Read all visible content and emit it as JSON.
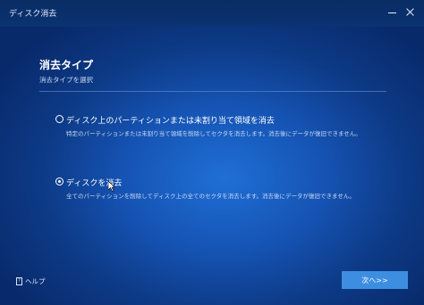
{
  "window": {
    "title": "ディスク消去",
    "minimize_icon": "minimize-icon",
    "close_icon": "close-icon"
  },
  "page": {
    "heading": "消去タイプ",
    "subheading": "消去タイプを選択"
  },
  "options": [
    {
      "label": "ディスク上のパーティションまたは未割り当て領域を消去",
      "description": "特定のパーティションまたは未割り当て領域を削除してセクタを消去します。消去後にデータが復旧できません。",
      "selected": false
    },
    {
      "label": "ディスクを消去",
      "description": "全てのパーティションを削除してディスク上の全てのセクタを消去します。消去後にデータが復旧できません。",
      "selected": true
    }
  ],
  "footer": {
    "help_label": "ヘルプ",
    "help_icon": "help-book-icon",
    "next_label": "次へ>>"
  },
  "colors": {
    "accent": "#3d8ee0",
    "background_center": "#1f6fd6",
    "background_edge": "#08296a",
    "titlebar": "#0a2c63"
  }
}
